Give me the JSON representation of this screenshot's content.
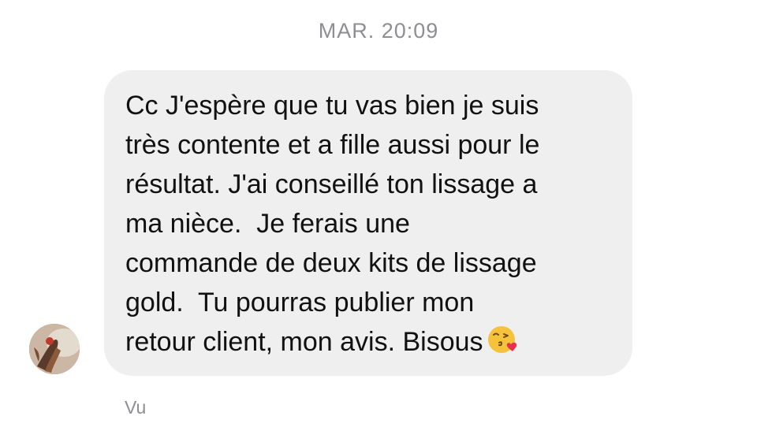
{
  "conversation": {
    "timestamp": "MAR. 20:09",
    "message": {
      "lines": [
        "Cc J'espère que tu vas bien je suis",
        "très contente et a fille aussi pour le",
        "résultat. J'ai conseillé ton lissage a",
        "ma nièce.  Je ferais une",
        "commande de deux kits de lissage",
        "gold.  Tu pourras publier mon",
        "retour client, mon avis. Bisous"
      ],
      "emoji": "kissing-face-with-heart-emoji"
    },
    "seen_label": "Vu",
    "colors": {
      "bubble_background": "#efeff0",
      "meta_text": "#8e8e93",
      "message_text": "#111111"
    }
  }
}
